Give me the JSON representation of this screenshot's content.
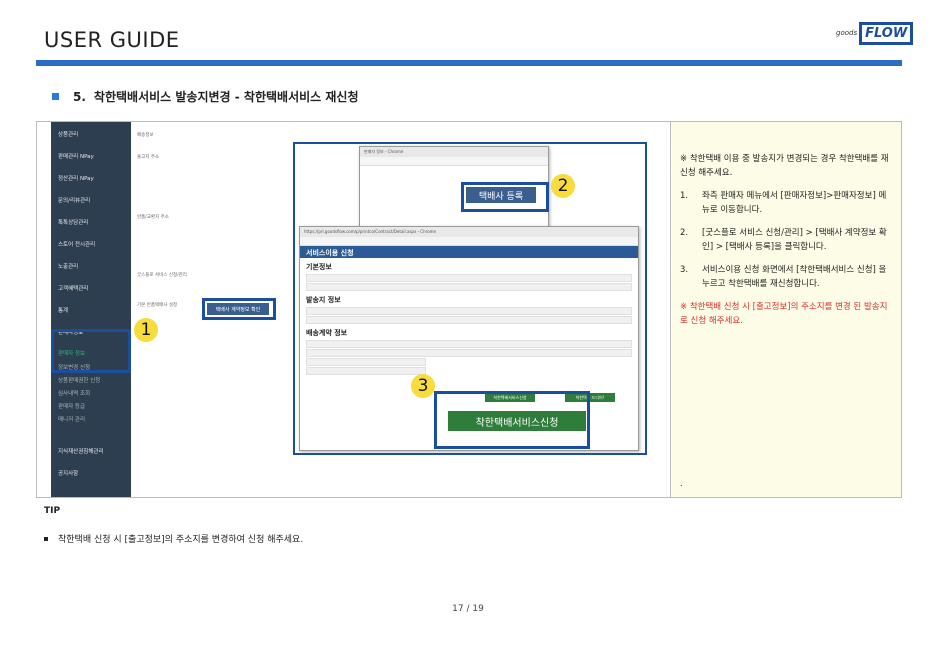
{
  "header": {
    "title": "USER GUIDE",
    "logo_small": "goods",
    "logo_main": "FLOW"
  },
  "section": {
    "number": "5.",
    "title": "착한택배서비스 발송지변경 - 착한택배서비스 재신청"
  },
  "screenshot": {
    "sidebar_items": [
      "상품관리",
      "판매관리 NPay",
      "정산관리 NPay",
      "문의/리뷰관리",
      "톡톡상담관리",
      "스토어 전시관리",
      "노출관리",
      "고객혜택관리",
      "통계",
      "판매자정보",
      "판매자 정보",
      "정보변경 신청",
      "상품판매권한 신청",
      "심사내역 조회",
      "판매자 등급",
      "매니저 관리",
      "지식재산권침해관리",
      "공지사항"
    ],
    "content_labels": [
      "배송정보",
      "출고지 주소",
      "반품/교환지 주소",
      "굿스플로 서비스 신청/관리",
      "기본 반품택배사 설정"
    ],
    "popup1_title": "판매자 정보 - Chrome",
    "popup1_button": "택배사 등록",
    "popup2_url": "https://prl.goodsflow.com/p/printco/Contract/Detail.aspx - Chrome",
    "popup2_heading": "서비스이용 신청",
    "popup2_sections": [
      "기본정보",
      "발송지 정보",
      "배송계약 정보"
    ],
    "small_button": "택배사 계약정보 확인",
    "apply_button": "착한택배서비스신청",
    "green_small_left": "착한택배서비스신청",
    "green_small_right": "착한택배 드디어!",
    "callouts": [
      "1",
      "2",
      "3"
    ]
  },
  "panel": {
    "intro": "※ 착한택배 이용 중 발송지가 변경되는 경우 착한택배를 재신청 해주세요.",
    "steps": [
      {
        "n": "1.",
        "text": "좌측 판매자 메뉴에서 [판매자정보]>판매자정보] 메뉴로 이동합니다."
      },
      {
        "n": "2.",
        "text": "[굿스플로 서비스 신청/관리] > [택배사 계약정보 확인] > [택배사 등록]을 클릭합니다."
      },
      {
        "n": "3.",
        "text": "서비스이용 신청 화면에서 [착한택배서비스 신청] 을 누르고 착한택배를 재신청합니다."
      }
    ],
    "warning": "※ 착한택배 신청 시 [출고정보]의 주소지를 변경 된 발송지로 신청 해주세요.",
    "trailing": "."
  },
  "tip": {
    "label": "TIP",
    "item": "착한택배 신청 시 [출고정보]의 주소지를 변경하여 신청 해주세요."
  },
  "footer": {
    "page": "17 / 19"
  }
}
